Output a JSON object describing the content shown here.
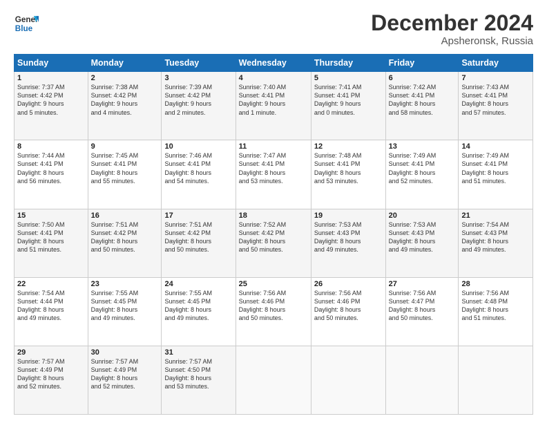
{
  "header": {
    "logo_line1": "General",
    "logo_line2": "Blue",
    "month": "December 2024",
    "location": "Apsheronsk, Russia"
  },
  "days_of_week": [
    "Sunday",
    "Monday",
    "Tuesday",
    "Wednesday",
    "Thursday",
    "Friday",
    "Saturday"
  ],
  "weeks": [
    [
      {
        "num": "1",
        "info": "Sunrise: 7:37 AM\nSunset: 4:42 PM\nDaylight: 9 hours\nand 5 minutes."
      },
      {
        "num": "2",
        "info": "Sunrise: 7:38 AM\nSunset: 4:42 PM\nDaylight: 9 hours\nand 4 minutes."
      },
      {
        "num": "3",
        "info": "Sunrise: 7:39 AM\nSunset: 4:42 PM\nDaylight: 9 hours\nand 2 minutes."
      },
      {
        "num": "4",
        "info": "Sunrise: 7:40 AM\nSunset: 4:41 PM\nDaylight: 9 hours\nand 1 minute."
      },
      {
        "num": "5",
        "info": "Sunrise: 7:41 AM\nSunset: 4:41 PM\nDaylight: 9 hours\nand 0 minutes."
      },
      {
        "num": "6",
        "info": "Sunrise: 7:42 AM\nSunset: 4:41 PM\nDaylight: 8 hours\nand 58 minutes."
      },
      {
        "num": "7",
        "info": "Sunrise: 7:43 AM\nSunset: 4:41 PM\nDaylight: 8 hours\nand 57 minutes."
      }
    ],
    [
      {
        "num": "8",
        "info": "Sunrise: 7:44 AM\nSunset: 4:41 PM\nDaylight: 8 hours\nand 56 minutes."
      },
      {
        "num": "9",
        "info": "Sunrise: 7:45 AM\nSunset: 4:41 PM\nDaylight: 8 hours\nand 55 minutes."
      },
      {
        "num": "10",
        "info": "Sunrise: 7:46 AM\nSunset: 4:41 PM\nDaylight: 8 hours\nand 54 minutes."
      },
      {
        "num": "11",
        "info": "Sunrise: 7:47 AM\nSunset: 4:41 PM\nDaylight: 8 hours\nand 53 minutes."
      },
      {
        "num": "12",
        "info": "Sunrise: 7:48 AM\nSunset: 4:41 PM\nDaylight: 8 hours\nand 53 minutes."
      },
      {
        "num": "13",
        "info": "Sunrise: 7:49 AM\nSunset: 4:41 PM\nDaylight: 8 hours\nand 52 minutes."
      },
      {
        "num": "14",
        "info": "Sunrise: 7:49 AM\nSunset: 4:41 PM\nDaylight: 8 hours\nand 51 minutes."
      }
    ],
    [
      {
        "num": "15",
        "info": "Sunrise: 7:50 AM\nSunset: 4:41 PM\nDaylight: 8 hours\nand 51 minutes."
      },
      {
        "num": "16",
        "info": "Sunrise: 7:51 AM\nSunset: 4:42 PM\nDaylight: 8 hours\nand 50 minutes."
      },
      {
        "num": "17",
        "info": "Sunrise: 7:51 AM\nSunset: 4:42 PM\nDaylight: 8 hours\nand 50 minutes."
      },
      {
        "num": "18",
        "info": "Sunrise: 7:52 AM\nSunset: 4:42 PM\nDaylight: 8 hours\nand 50 minutes."
      },
      {
        "num": "19",
        "info": "Sunrise: 7:53 AM\nSunset: 4:43 PM\nDaylight: 8 hours\nand 49 minutes."
      },
      {
        "num": "20",
        "info": "Sunrise: 7:53 AM\nSunset: 4:43 PM\nDaylight: 8 hours\nand 49 minutes."
      },
      {
        "num": "21",
        "info": "Sunrise: 7:54 AM\nSunset: 4:43 PM\nDaylight: 8 hours\nand 49 minutes."
      }
    ],
    [
      {
        "num": "22",
        "info": "Sunrise: 7:54 AM\nSunset: 4:44 PM\nDaylight: 8 hours\nand 49 minutes."
      },
      {
        "num": "23",
        "info": "Sunrise: 7:55 AM\nSunset: 4:45 PM\nDaylight: 8 hours\nand 49 minutes."
      },
      {
        "num": "24",
        "info": "Sunrise: 7:55 AM\nSunset: 4:45 PM\nDaylight: 8 hours\nand 49 minutes."
      },
      {
        "num": "25",
        "info": "Sunrise: 7:56 AM\nSunset: 4:46 PM\nDaylight: 8 hours\nand 50 minutes."
      },
      {
        "num": "26",
        "info": "Sunrise: 7:56 AM\nSunset: 4:46 PM\nDaylight: 8 hours\nand 50 minutes."
      },
      {
        "num": "27",
        "info": "Sunrise: 7:56 AM\nSunset: 4:47 PM\nDaylight: 8 hours\nand 50 minutes."
      },
      {
        "num": "28",
        "info": "Sunrise: 7:56 AM\nSunset: 4:48 PM\nDaylight: 8 hours\nand 51 minutes."
      }
    ],
    [
      {
        "num": "29",
        "info": "Sunrise: 7:57 AM\nSunset: 4:49 PM\nDaylight: 8 hours\nand 52 minutes."
      },
      {
        "num": "30",
        "info": "Sunrise: 7:57 AM\nSunset: 4:49 PM\nDaylight: 8 hours\nand 52 minutes."
      },
      {
        "num": "31",
        "info": "Sunrise: 7:57 AM\nSunset: 4:50 PM\nDaylight: 8 hours\nand 53 minutes."
      },
      {
        "num": "",
        "info": ""
      },
      {
        "num": "",
        "info": ""
      },
      {
        "num": "",
        "info": ""
      },
      {
        "num": "",
        "info": ""
      }
    ]
  ]
}
